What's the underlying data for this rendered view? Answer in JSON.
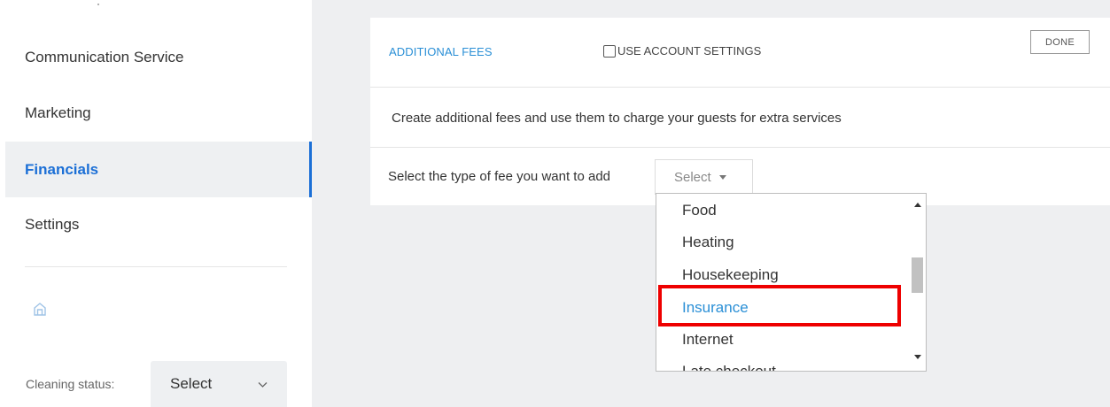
{
  "sidebar": {
    "items": [
      {
        "label": "Communication Service"
      },
      {
        "label": "Marketing"
      },
      {
        "label": "Financials"
      },
      {
        "label": "Settings"
      }
    ],
    "active_index": 2,
    "home_icon": "home-icon",
    "cleaning_status_label": "Cleaning status:",
    "cleaning_status_value": "Select"
  },
  "fees": {
    "title": "ADDITIONAL FEES",
    "use_account_settings": "USE ACCOUNT SETTINGS",
    "use_account_checked": false,
    "done_label": "DONE",
    "description": "Create additional fees and use them to charge your guests for extra services",
    "select_type_label": "Select the type of fee you want to add",
    "select_placeholder": "Select"
  },
  "dropdown": {
    "options": [
      "Food",
      "Heating",
      "Housekeeping",
      "Insurance",
      "Internet",
      "Late checkout"
    ],
    "highlighted": "Insurance"
  },
  "colors": {
    "accent": "#1b6fd6",
    "link_blue": "#2a8fd6",
    "highlight_red": "#ee0000",
    "panel_bg": "#eeeff1"
  }
}
